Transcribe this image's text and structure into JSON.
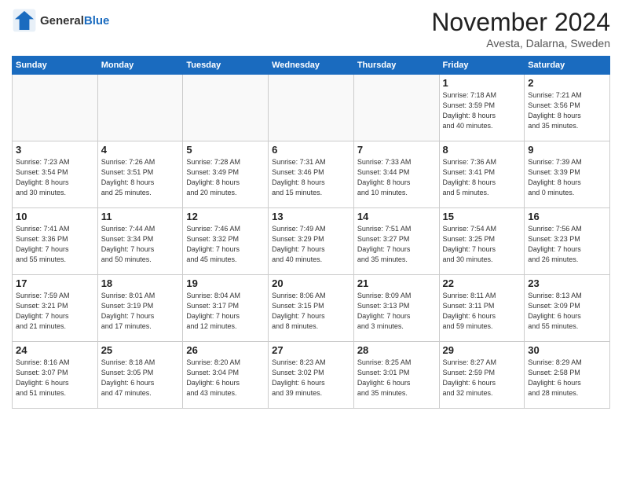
{
  "logo": {
    "general": "General",
    "blue": "Blue"
  },
  "header": {
    "month": "November 2024",
    "location": "Avesta, Dalarna, Sweden"
  },
  "weekdays": [
    "Sunday",
    "Monday",
    "Tuesday",
    "Wednesday",
    "Thursday",
    "Friday",
    "Saturday"
  ],
  "weeks": [
    [
      {
        "day": "",
        "info": ""
      },
      {
        "day": "",
        "info": ""
      },
      {
        "day": "",
        "info": ""
      },
      {
        "day": "",
        "info": ""
      },
      {
        "day": "",
        "info": ""
      },
      {
        "day": "1",
        "info": "Sunrise: 7:18 AM\nSunset: 3:59 PM\nDaylight: 8 hours\nand 40 minutes."
      },
      {
        "day": "2",
        "info": "Sunrise: 7:21 AM\nSunset: 3:56 PM\nDaylight: 8 hours\nand 35 minutes."
      }
    ],
    [
      {
        "day": "3",
        "info": "Sunrise: 7:23 AM\nSunset: 3:54 PM\nDaylight: 8 hours\nand 30 minutes."
      },
      {
        "day": "4",
        "info": "Sunrise: 7:26 AM\nSunset: 3:51 PM\nDaylight: 8 hours\nand 25 minutes."
      },
      {
        "day": "5",
        "info": "Sunrise: 7:28 AM\nSunset: 3:49 PM\nDaylight: 8 hours\nand 20 minutes."
      },
      {
        "day": "6",
        "info": "Sunrise: 7:31 AM\nSunset: 3:46 PM\nDaylight: 8 hours\nand 15 minutes."
      },
      {
        "day": "7",
        "info": "Sunrise: 7:33 AM\nSunset: 3:44 PM\nDaylight: 8 hours\nand 10 minutes."
      },
      {
        "day": "8",
        "info": "Sunrise: 7:36 AM\nSunset: 3:41 PM\nDaylight: 8 hours\nand 5 minutes."
      },
      {
        "day": "9",
        "info": "Sunrise: 7:39 AM\nSunset: 3:39 PM\nDaylight: 8 hours\nand 0 minutes."
      }
    ],
    [
      {
        "day": "10",
        "info": "Sunrise: 7:41 AM\nSunset: 3:36 PM\nDaylight: 7 hours\nand 55 minutes."
      },
      {
        "day": "11",
        "info": "Sunrise: 7:44 AM\nSunset: 3:34 PM\nDaylight: 7 hours\nand 50 minutes."
      },
      {
        "day": "12",
        "info": "Sunrise: 7:46 AM\nSunset: 3:32 PM\nDaylight: 7 hours\nand 45 minutes."
      },
      {
        "day": "13",
        "info": "Sunrise: 7:49 AM\nSunset: 3:29 PM\nDaylight: 7 hours\nand 40 minutes."
      },
      {
        "day": "14",
        "info": "Sunrise: 7:51 AM\nSunset: 3:27 PM\nDaylight: 7 hours\nand 35 minutes."
      },
      {
        "day": "15",
        "info": "Sunrise: 7:54 AM\nSunset: 3:25 PM\nDaylight: 7 hours\nand 30 minutes."
      },
      {
        "day": "16",
        "info": "Sunrise: 7:56 AM\nSunset: 3:23 PM\nDaylight: 7 hours\nand 26 minutes."
      }
    ],
    [
      {
        "day": "17",
        "info": "Sunrise: 7:59 AM\nSunset: 3:21 PM\nDaylight: 7 hours\nand 21 minutes."
      },
      {
        "day": "18",
        "info": "Sunrise: 8:01 AM\nSunset: 3:19 PM\nDaylight: 7 hours\nand 17 minutes."
      },
      {
        "day": "19",
        "info": "Sunrise: 8:04 AM\nSunset: 3:17 PM\nDaylight: 7 hours\nand 12 minutes."
      },
      {
        "day": "20",
        "info": "Sunrise: 8:06 AM\nSunset: 3:15 PM\nDaylight: 7 hours\nand 8 minutes."
      },
      {
        "day": "21",
        "info": "Sunrise: 8:09 AM\nSunset: 3:13 PM\nDaylight: 7 hours\nand 3 minutes."
      },
      {
        "day": "22",
        "info": "Sunrise: 8:11 AM\nSunset: 3:11 PM\nDaylight: 6 hours\nand 59 minutes."
      },
      {
        "day": "23",
        "info": "Sunrise: 8:13 AM\nSunset: 3:09 PM\nDaylight: 6 hours\nand 55 minutes."
      }
    ],
    [
      {
        "day": "24",
        "info": "Sunrise: 8:16 AM\nSunset: 3:07 PM\nDaylight: 6 hours\nand 51 minutes."
      },
      {
        "day": "25",
        "info": "Sunrise: 8:18 AM\nSunset: 3:05 PM\nDaylight: 6 hours\nand 47 minutes."
      },
      {
        "day": "26",
        "info": "Sunrise: 8:20 AM\nSunset: 3:04 PM\nDaylight: 6 hours\nand 43 minutes."
      },
      {
        "day": "27",
        "info": "Sunrise: 8:23 AM\nSunset: 3:02 PM\nDaylight: 6 hours\nand 39 minutes."
      },
      {
        "day": "28",
        "info": "Sunrise: 8:25 AM\nSunset: 3:01 PM\nDaylight: 6 hours\nand 35 minutes."
      },
      {
        "day": "29",
        "info": "Sunrise: 8:27 AM\nSunset: 2:59 PM\nDaylight: 6 hours\nand 32 minutes."
      },
      {
        "day": "30",
        "info": "Sunrise: 8:29 AM\nSunset: 2:58 PM\nDaylight: 6 hours\nand 28 minutes."
      }
    ]
  ]
}
